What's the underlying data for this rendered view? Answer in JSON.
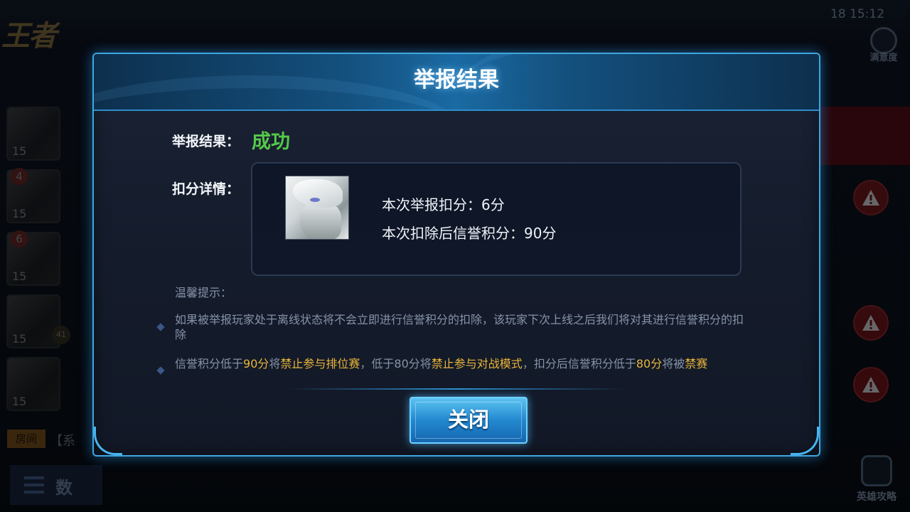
{
  "background": {
    "logo_text": "王者",
    "time_text": "18 15:12",
    "satisfaction_label": "满意度",
    "heroes": [
      {
        "level": "15",
        "rank": "",
        "side": ""
      },
      {
        "level": "15",
        "rank": "4",
        "side": ""
      },
      {
        "level": "15",
        "rank": "6",
        "side": ""
      },
      {
        "level": "15",
        "rank": "",
        "side": "41"
      },
      {
        "level": "15",
        "rank": "",
        "side": ""
      }
    ],
    "room_tag": "房间",
    "room_text": "【系",
    "data_button_label": "数",
    "guide_label": "英雄攻略",
    "colors": {
      "warning": "#7a1519",
      "room_tag": "#b8731d"
    }
  },
  "dialog": {
    "title": "举报结果",
    "result_label": "举报结果：",
    "result_value": "成功",
    "detail_label": "扣分详情：",
    "deduction_text": "本次举报扣分：6分",
    "remaining_text": "本次扣除后信誉积分：90分",
    "tips_title": "温馨提示：",
    "tip1": "如果被举报玩家处于离线状态将不会立即进行信誉积分的扣除，该玩家下次上线之后我们将对其进行信誉积分的扣除",
    "tip2": {
      "p1": "信誉积分低于",
      "h1": "90分",
      "p2": "将",
      "h2": "禁止参与排位赛",
      "p3": "，低于80分将",
      "h3": "禁止参与对战模式",
      "p4": "，扣分后信誉积分低于",
      "h4": "80分",
      "p5": "将被",
      "h5": "禁赛"
    },
    "close_label": "关闭",
    "colors": {
      "success": "#55c94a",
      "highlight": "#e9b53a",
      "accent": "#3fa6df"
    }
  }
}
